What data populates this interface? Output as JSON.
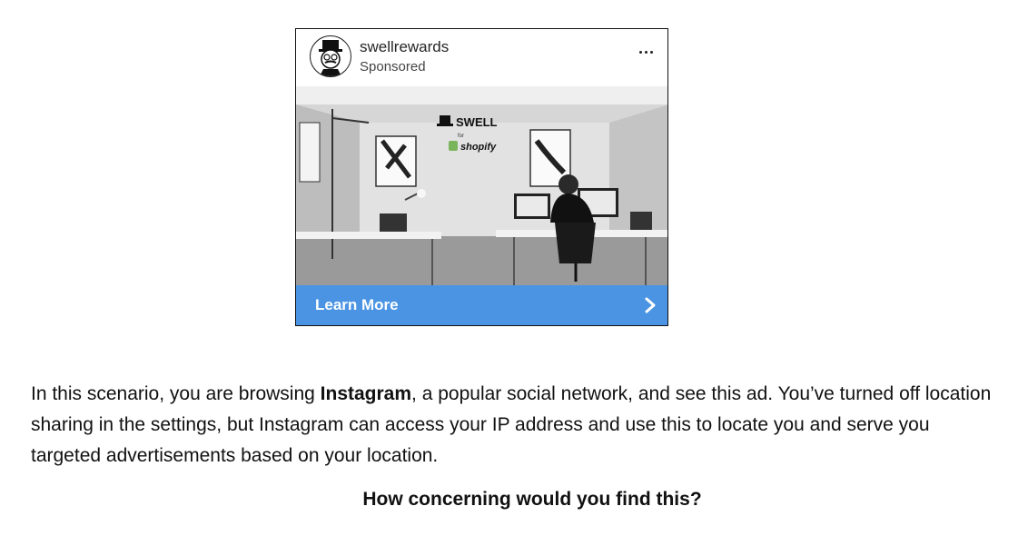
{
  "ad": {
    "account_name": "swellrewards",
    "sponsored_label": "Sponsored",
    "more_icon": "more-horizontal-icon",
    "brand_logo_text": "SWELL",
    "brand_for_text": "for",
    "partner_logo_text": "shopify",
    "cta_label": "Learn More",
    "cta_icon": "chevron-right-icon",
    "cta_color": "#4a94e3"
  },
  "scenario": {
    "intro": "In this scenario, you are browsing ",
    "platform": "Instagram",
    "rest": ", a popular social network, and see this ad. You’ve turned off location sharing in the settings, but Instagram can access your IP address and use this to locate you and serve you targeted advertisements based on your location."
  },
  "question": "How concerning would you find this?"
}
